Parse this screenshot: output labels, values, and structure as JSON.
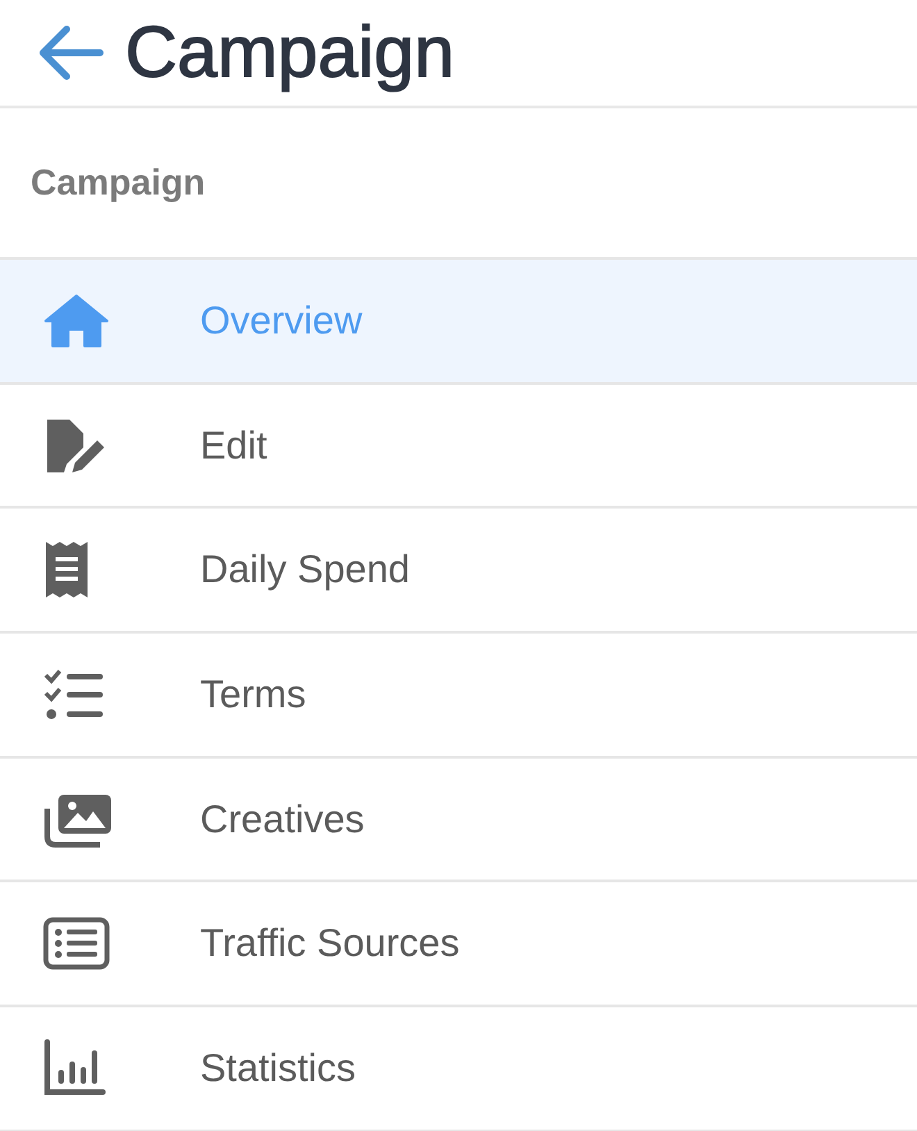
{
  "header": {
    "title": "Campaign"
  },
  "section": {
    "label": "Campaign"
  },
  "items": [
    {
      "label": "Overview",
      "selected": true
    },
    {
      "label": "Edit",
      "selected": false
    },
    {
      "label": "Daily Spend",
      "selected": false
    },
    {
      "label": "Terms",
      "selected": false
    },
    {
      "label": "Creatives",
      "selected": false
    },
    {
      "label": "Traffic Sources",
      "selected": false
    },
    {
      "label": "Statistics",
      "selected": false
    }
  ]
}
